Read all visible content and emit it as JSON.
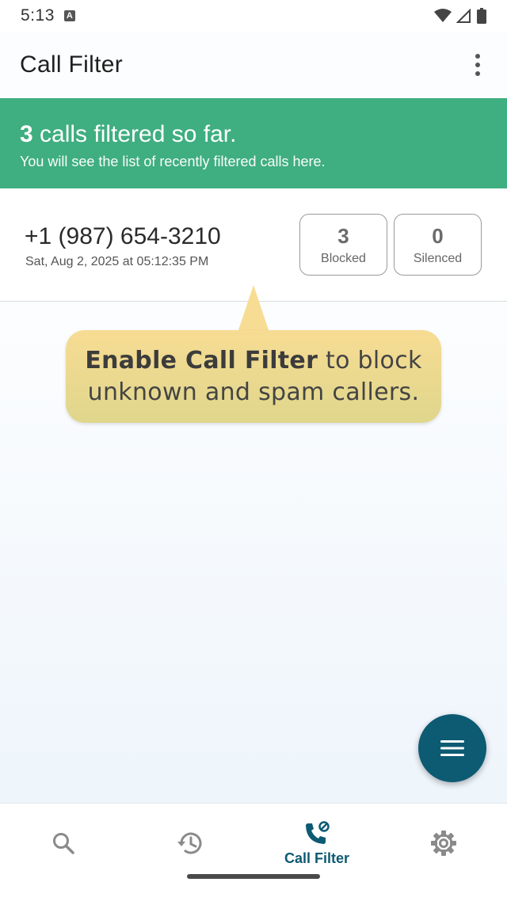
{
  "status_bar": {
    "time": "5:13",
    "badge": "A"
  },
  "app_bar": {
    "title": "Call Filter"
  },
  "banner": {
    "count": "3",
    "headline_rest": " calls filtered so far.",
    "subtitle": "You will see the list of recently filtered calls here."
  },
  "call": {
    "number": "+1 (987) 654-3210",
    "date": "Sat, Aug 2, 2025 at 05:12:35 PM",
    "blocked_count": "3",
    "blocked_label": "Blocked",
    "silenced_count": "0",
    "silenced_label": "Silenced"
  },
  "tooltip": {
    "bold": "Enable Call Filter",
    "rest_line1": " to block",
    "line2": "unknown and spam callers."
  },
  "bottom_nav": {
    "items": [
      {
        "icon": "search-icon",
        "label": ""
      },
      {
        "icon": "history-icon",
        "label": ""
      },
      {
        "icon": "call-filter-icon",
        "label": "Call Filter"
      },
      {
        "icon": "gear-icon",
        "label": ""
      }
    ]
  },
  "colors": {
    "banner": "#3fae80",
    "accent": "#0d5a73",
    "tooltip": "#f7dc93"
  }
}
